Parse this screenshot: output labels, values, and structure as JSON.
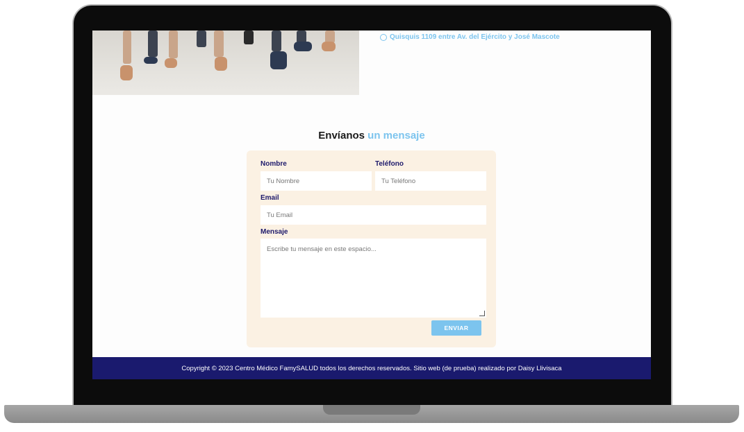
{
  "header": {
    "address": "Quisquis 1109 entre Av. del Ejército y José Mascote"
  },
  "contact": {
    "title_main": "Envíanos",
    "title_accent": "un mensaje",
    "name_label": "Nombre",
    "name_placeholder": "Tu Nombre",
    "phone_label": "Teléfono",
    "phone_placeholder": "Tu Teléfono",
    "email_label": "Email",
    "email_placeholder": "Tu Email",
    "message_label": "Mensaje",
    "message_placeholder": "Escribe tu mensaje en este espacio...",
    "submit_label": "ENVIAR"
  },
  "footer": {
    "copyright": "Copyright © 2023 Centro Médico FamySALUD todos los derechos reservados. Sitio web (de prueba) realizado por Daisy Llivisaca"
  },
  "colors": {
    "accent": "#7cc4ee",
    "footer_bg": "#1a1a6e",
    "form_bg": "#fbf1e3"
  }
}
